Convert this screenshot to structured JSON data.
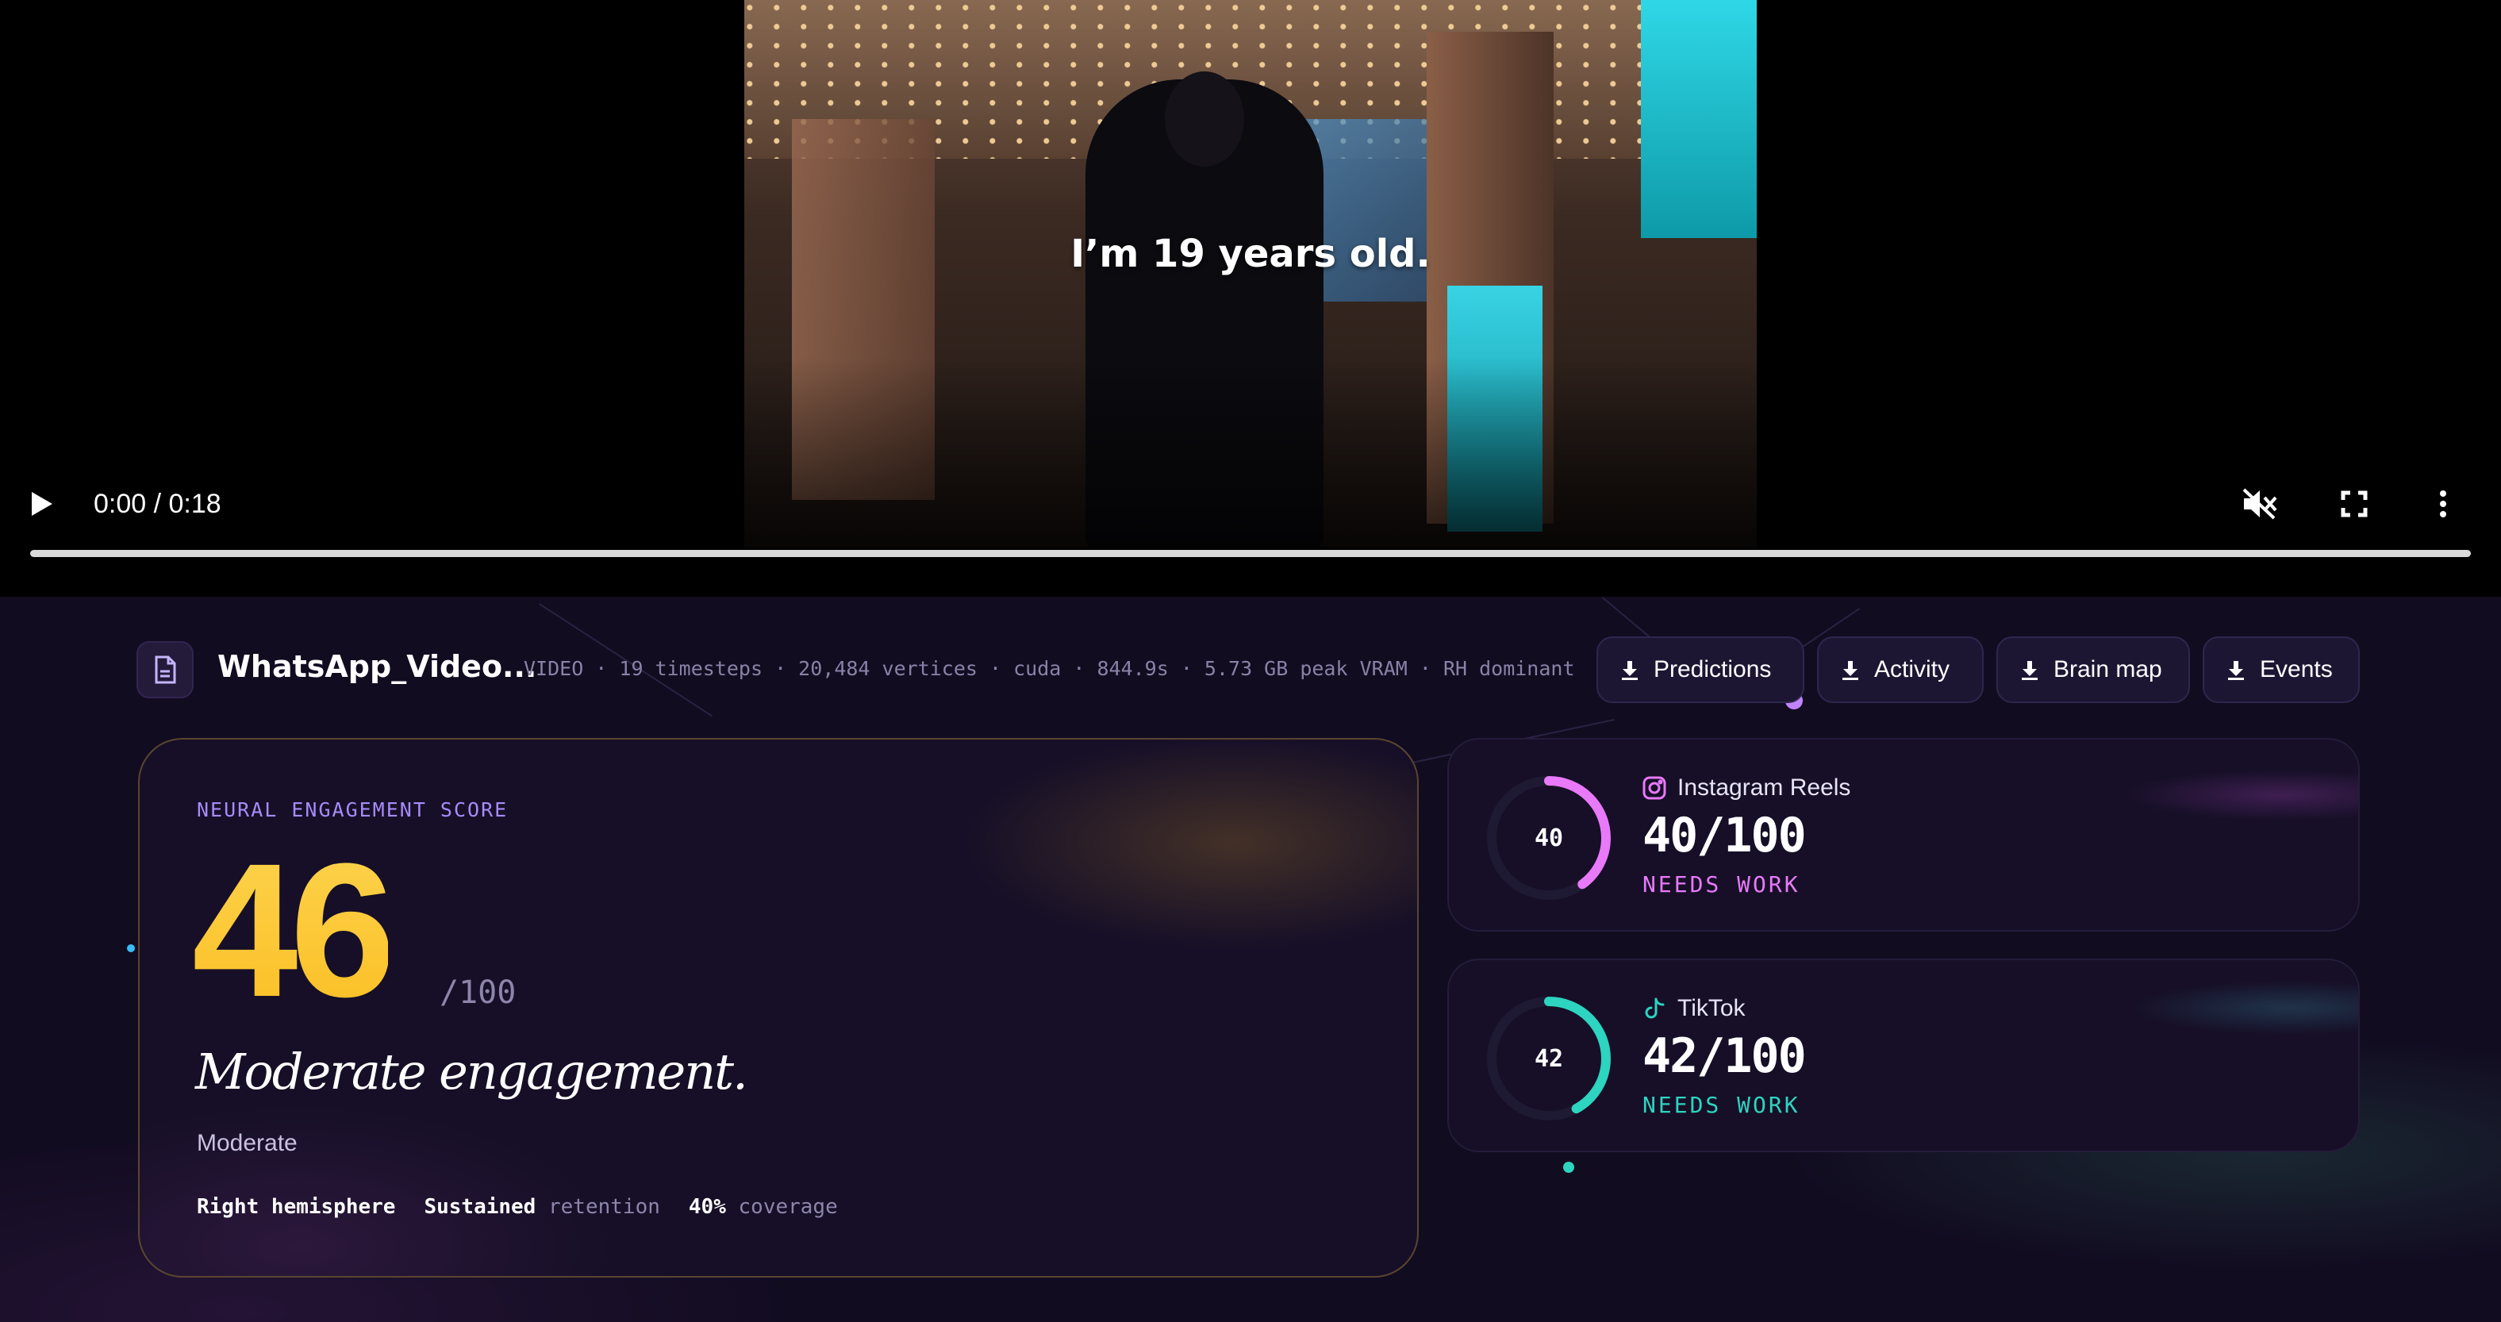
{
  "video": {
    "caption": "I’m 19 years old.",
    "time": "0:00 / 0:18",
    "progress": 0
  },
  "file": {
    "name": "WhatsApp_Video...",
    "meta": "VIDEO · 19 timesteps · 20,484 vertices · cuda · 844.9s · 5.73 GB peak VRAM · RH dominant"
  },
  "downloads": {
    "predictions": "Predictions",
    "activity": "Activity",
    "brain_map": "Brain map",
    "events": "Events"
  },
  "score": {
    "label": "NEURAL ENGAGEMENT SCORE",
    "value": "46",
    "out_of": "/100",
    "headline": "Moderate engagement.",
    "level": "Moderate",
    "stat1_bold": "Right hemisphere",
    "stat2_bold": "Sustained",
    "stat2_dim": "retention",
    "stat3_bold": "40%",
    "stat3_dim": "coverage"
  },
  "platforms": [
    {
      "name": "Instagram Reels",
      "ring_value": "40",
      "score": "40/100",
      "status": "NEEDS WORK",
      "fraction": 0.4,
      "color": "#e879f9"
    },
    {
      "name": "TikTok",
      "ring_value": "42",
      "score": "42/100",
      "status": "NEEDS WORK",
      "fraction": 0.42,
      "color": "#2dd4bf"
    }
  ],
  "colors": {
    "score_gold": "#fbbf24",
    "accent_purple": "#a78bfa",
    "instagram": "#e879f9",
    "tiktok": "#2dd4bf"
  }
}
